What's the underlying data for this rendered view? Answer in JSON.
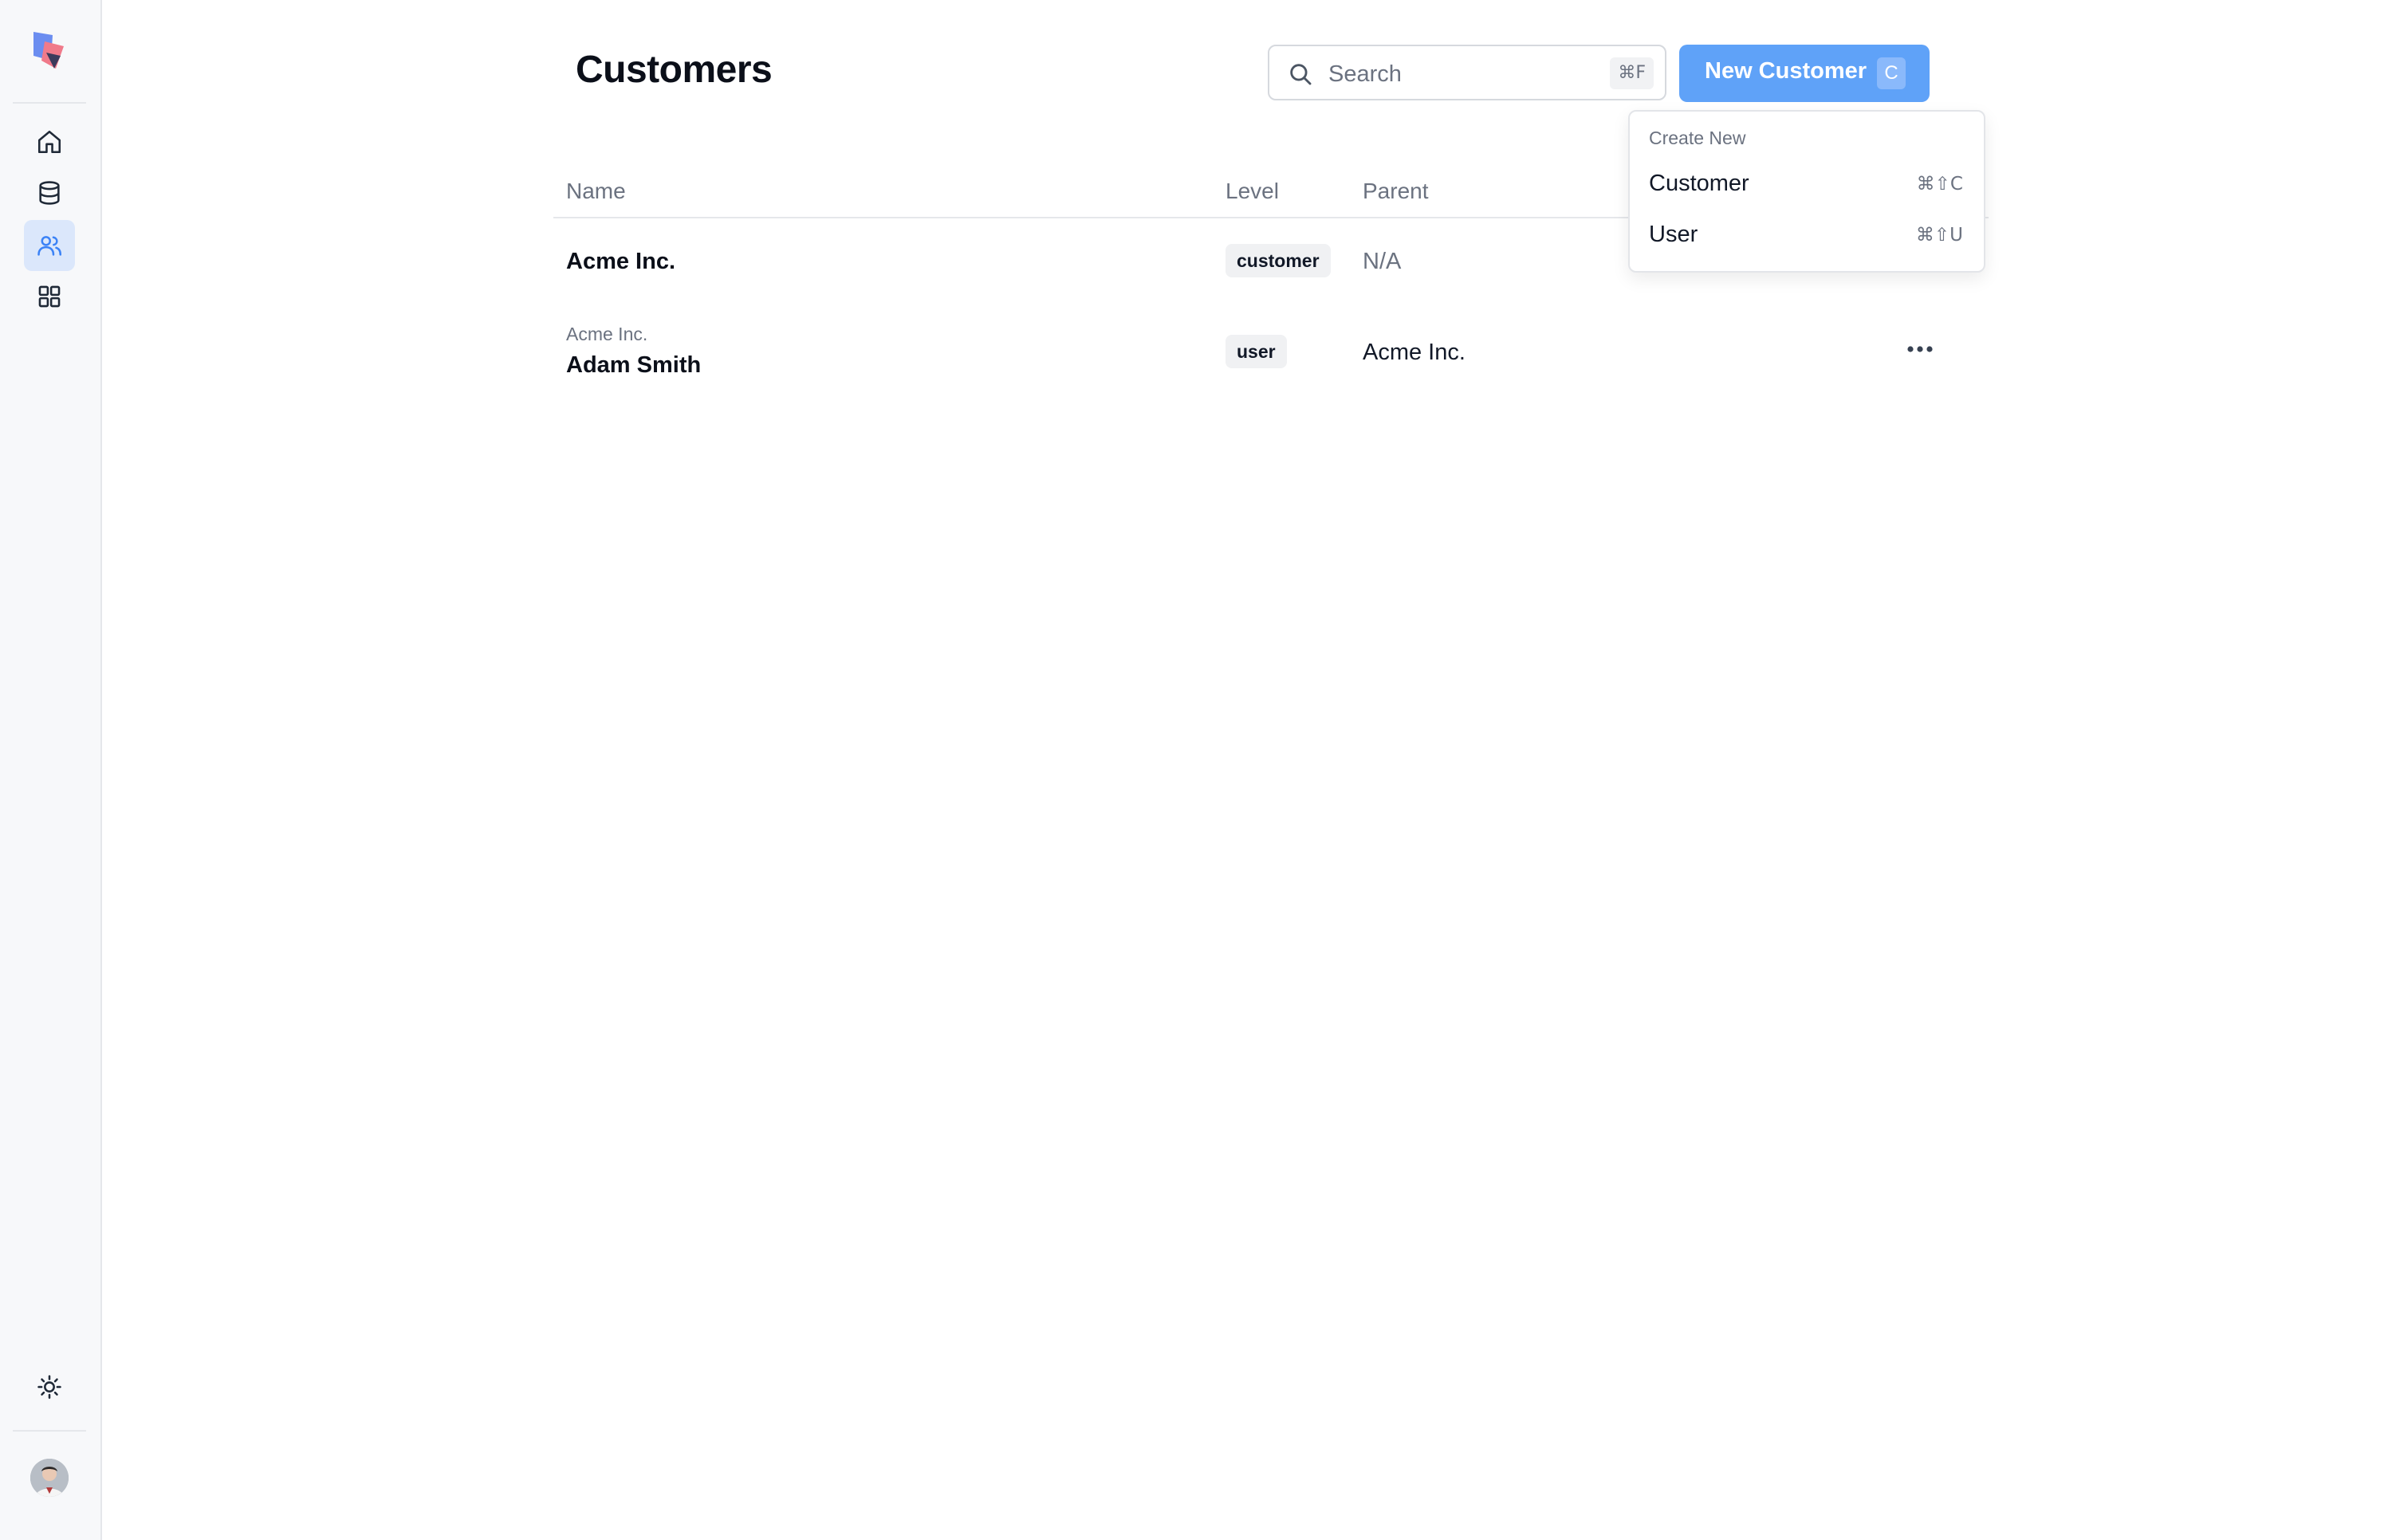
{
  "sidebar": {
    "nav": [
      {
        "icon": "home-icon",
        "active": false
      },
      {
        "icon": "database-icon",
        "active": false
      },
      {
        "icon": "users-icon",
        "active": true
      },
      {
        "icon": "dashboard-icon",
        "active": false
      }
    ],
    "theme_icon": "sun-icon",
    "avatar": "user-avatar"
  },
  "header": {
    "title": "Customers",
    "search": {
      "placeholder": "Search",
      "shortcut": "⌘F"
    },
    "new_button": {
      "label": "New Customer",
      "shortcut": "C"
    }
  },
  "dropdown": {
    "heading": "Create New",
    "items": [
      {
        "label": "Customer",
        "shortcut": "⌘⇧C"
      },
      {
        "label": "User",
        "shortcut": "⌘⇧U"
      }
    ]
  },
  "table": {
    "columns": [
      "Name",
      "Level",
      "Parent"
    ],
    "rows": [
      {
        "parent_name": "",
        "name": "Acme Inc.",
        "level": "customer",
        "parent": "N/A"
      },
      {
        "parent_name": "Acme Inc.",
        "name": "Adam Smith",
        "level": "user",
        "parent": "Acme Inc."
      }
    ]
  },
  "colors": {
    "accent": "#5fa2f8",
    "active_nav_bg": "#dbe7fb"
  }
}
